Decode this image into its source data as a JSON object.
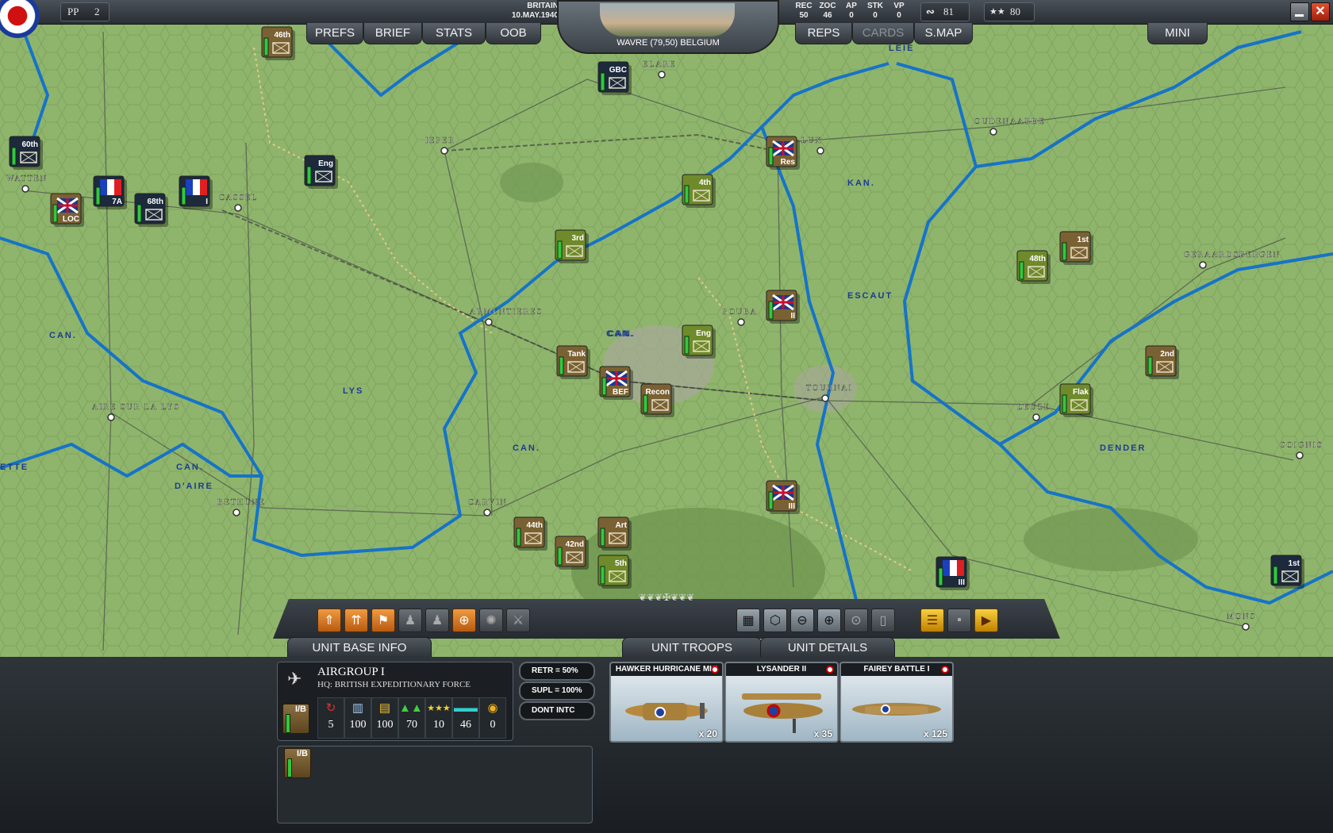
{
  "topbar": {
    "pp_label": "PP",
    "pp_value": "2",
    "nation": "BRITAIN",
    "date": "10.MAY.1940",
    "location": "WAVRE (79,50) BELGIUM",
    "rec_label": "REC",
    "rec_value": "50",
    "zoc_label": "ZOC",
    "zoc_value": "46",
    "ap_label": "AP",
    "ap_value": "0",
    "stk_label": "STK",
    "stk_value": "0",
    "vp_label": "VP",
    "vp_value": "0",
    "supply_value": "81",
    "stars_value": "80",
    "nav_left": [
      "PREFS",
      "BRIEF",
      "STATS",
      "OOB"
    ],
    "nav_right": [
      "REPS",
      "CARDS",
      "S.MAP"
    ],
    "mini": "MINI"
  },
  "map": {
    "places": [
      {
        "label": "IEPER"
      },
      {
        "label": "CASSEL"
      },
      {
        "label": "WATTEN"
      },
      {
        "label": "ARMENTIERES"
      },
      {
        "label": "AIRE SUR LA LYS"
      },
      {
        "label": "BETHUNE"
      },
      {
        "label": "CARVIN"
      },
      {
        "label": "TOURNAI"
      },
      {
        "label": "LEUZE"
      },
      {
        "label": "OUDENAARDE"
      },
      {
        "label": "GERAARDSBERGEN"
      },
      {
        "label": "SOIGNIS"
      },
      {
        "label": "MONS"
      },
      {
        "label": "ROUBA"
      },
      {
        "label": "ELARE"
      },
      {
        "label": "LUX"
      }
    ],
    "water": [
      {
        "label": "CAN."
      },
      {
        "label": "LYS"
      },
      {
        "label": "CAN."
      },
      {
        "label": "CAN."
      },
      {
        "label": "CAN."
      },
      {
        "label": "D'AIRE"
      },
      {
        "label": "CAN."
      },
      {
        "label": "KAN."
      },
      {
        "label": "ESCAUT"
      },
      {
        "label": "DENDER"
      },
      {
        "label": "LEIE"
      },
      {
        "label": "ETTE"
      }
    ],
    "units": [
      {
        "label": "46th"
      },
      {
        "label": "GBC"
      },
      {
        "label": "60th"
      },
      {
        "label": "LOC"
      },
      {
        "label": "7A"
      },
      {
        "label": "68th"
      },
      {
        "label": "I"
      },
      {
        "label": "Eng"
      },
      {
        "label": "Res"
      },
      {
        "label": "4th"
      },
      {
        "label": "3rd"
      },
      {
        "label": "II"
      },
      {
        "label": "Eng"
      },
      {
        "label": "Tank"
      },
      {
        "label": "BEF"
      },
      {
        "label": "Recon"
      },
      {
        "label": "48th"
      },
      {
        "label": "1st"
      },
      {
        "label": "2nd"
      },
      {
        "label": "Flak"
      },
      {
        "label": "III"
      },
      {
        "label": "44th"
      },
      {
        "label": "42nd"
      },
      {
        "label": "Art"
      },
      {
        "label": "5th"
      },
      {
        "label": "III"
      },
      {
        "label": "1st"
      }
    ]
  },
  "tabs": {
    "base_info": "UNIT BASE INFO",
    "troops": "UNIT TROOPS",
    "details": "UNIT DETAILS"
  },
  "unit": {
    "name": "AIRGROUP I",
    "hq": "HQ: BRITISH EXPEDITIONARY FORCE",
    "badge": "I/B",
    "stats": [
      {
        "icon": "refresh-icon",
        "value": "5"
      },
      {
        "icon": "troops-icon",
        "value": "100"
      },
      {
        "icon": "supply-icon",
        "value": "100"
      },
      {
        "icon": "morale-icon",
        "value": "70"
      },
      {
        "icon": "experience-icon",
        "value": "10"
      },
      {
        "icon": "entrench-icon",
        "value": "46"
      },
      {
        "icon": "gold-icon",
        "value": "0"
      }
    ]
  },
  "options": {
    "retr": "RETR = 50%",
    "supl": "SUPL = 100%",
    "intc": "DONT INTC"
  },
  "cards": [
    {
      "title": "HAWKER HURRICANE MKI",
      "count": "x 20"
    },
    {
      "title": "LYSANDER II",
      "count": "x 35"
    },
    {
      "title": "FAIREY BATTLE I",
      "count": "x 125"
    }
  ],
  "colors": {
    "map_green": "#8db36a",
    "river_blue": "#1673c8",
    "counter_brown": "#7a6133",
    "counter_green": "#6f8a2a",
    "counter_navy": "#1c2a3c"
  }
}
